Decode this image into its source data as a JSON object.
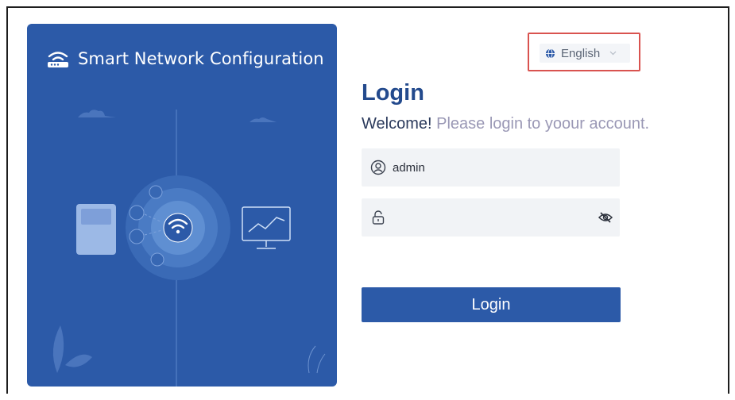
{
  "promo": {
    "title": "Smart Network Configuration",
    "brand_color": "#2c5aa8",
    "icons": [
      "router-icon",
      "wifi-icon",
      "monitor-chart-icon",
      "device-icon"
    ]
  },
  "language": {
    "selected": "English",
    "icon": "globe-icon"
  },
  "login": {
    "title": "Login",
    "welcome_strong": "Welcome!",
    "welcome_rest": " Please login to yoour account.",
    "username_value": "admin",
    "password_value": "",
    "button_label": "Login",
    "highlight_color": "#d9534f"
  }
}
